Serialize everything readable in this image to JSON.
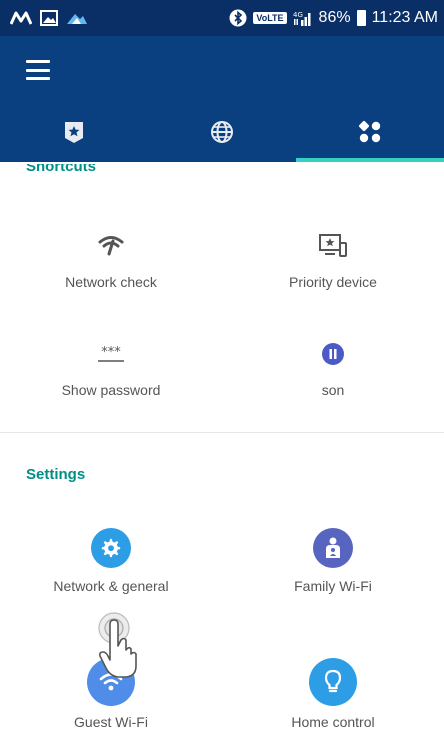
{
  "status_bar": {
    "volte_label": "VoLTE",
    "battery": "86%",
    "time": "11:23 AM"
  },
  "tabs": [
    {
      "name": "tab-home",
      "icon": "shield-star-icon",
      "active": false
    },
    {
      "name": "tab-internet",
      "icon": "globe-icon",
      "active": false
    },
    {
      "name": "tab-more",
      "icon": "grid-dots-icon",
      "active": true
    }
  ],
  "shortcuts": {
    "title": "Shortcuts",
    "items": [
      {
        "label": "Network check",
        "icon": "network-check-icon"
      },
      {
        "label": "Priority device",
        "icon": "priority-device-icon"
      },
      {
        "label": "Show password",
        "icon": "password-icon",
        "glyph": "***"
      },
      {
        "label": "son",
        "icon": "pause-icon"
      }
    ]
  },
  "settings": {
    "title": "Settings",
    "items": [
      {
        "label": "Network & general",
        "icon": "gear-icon",
        "color": "#2d9ee6"
      },
      {
        "label": "Family Wi-Fi",
        "icon": "family-icon",
        "color": "#5865c0"
      },
      {
        "label": "Guest Wi-Fi",
        "icon": "wifi-icon",
        "color": "#4f8de8"
      },
      {
        "label": "Home control",
        "icon": "lightbulb-icon",
        "color": "#2d9ee6"
      }
    ]
  },
  "colors": {
    "status_bar": "#0a2f66",
    "app_bar": "#0a3f80",
    "accent": "#35d0c0",
    "section_title": "#008f86"
  }
}
